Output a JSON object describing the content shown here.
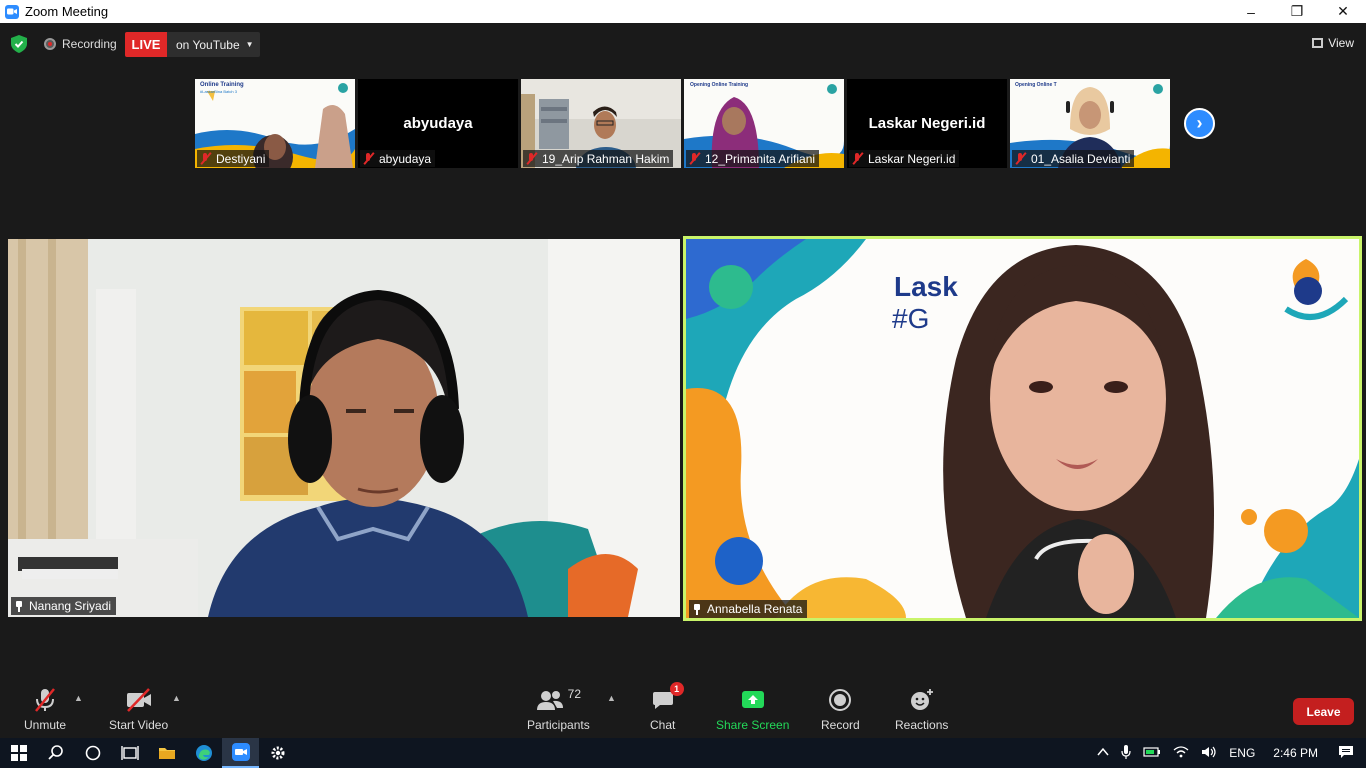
{
  "window": {
    "title": "Zoom Meeting",
    "controls": [
      "–",
      "❐",
      "✕"
    ]
  },
  "topbar": {
    "recording_label": "Recording",
    "live_label": "LIVE",
    "stream_label": "on YouTube",
    "view_label": "View"
  },
  "thumbnails": [
    {
      "name": "Destiyani",
      "type": "video",
      "overlay_title": "Online Training",
      "overlay_sub": "#LaskarBina Batch 3"
    },
    {
      "name": "abyudaya",
      "type": "name",
      "center": "abyudaya"
    },
    {
      "name": "19_Arip Rahman Hakim",
      "type": "video"
    },
    {
      "name": "12_Primanita Arifiani",
      "type": "video",
      "overlay_title": "Opening Online Training"
    },
    {
      "name": "Laskar Negeri.id",
      "type": "name",
      "center": "Laskar Negeri.id"
    },
    {
      "name": "01_Asalia Devianti",
      "type": "video",
      "overlay_title": "Opening Online T"
    }
  ],
  "main_videos": [
    {
      "name": "Nanang Sriyadi",
      "pinned": true
    },
    {
      "name": "Annabella Renata",
      "pinned": true,
      "active_speaker": true,
      "bg_text_1": "Lask",
      "bg_text_2": "#G"
    }
  ],
  "toolbar": {
    "unmute": "Unmute",
    "start_video": "Start Video",
    "participants": "Participants",
    "participants_count": "72",
    "chat": "Chat",
    "chat_badge": "1",
    "share_screen": "Share Screen",
    "record": "Record",
    "reactions": "Reactions",
    "leave": "Leave"
  },
  "taskbar": {
    "language": "ENG",
    "time": "2:46 PM"
  },
  "colors": {
    "accent": "#2d8cff",
    "live_red": "#e02828",
    "share_green": "#23d959",
    "speaker_border": "#c9f46a",
    "leave_red": "#c41f1f"
  }
}
